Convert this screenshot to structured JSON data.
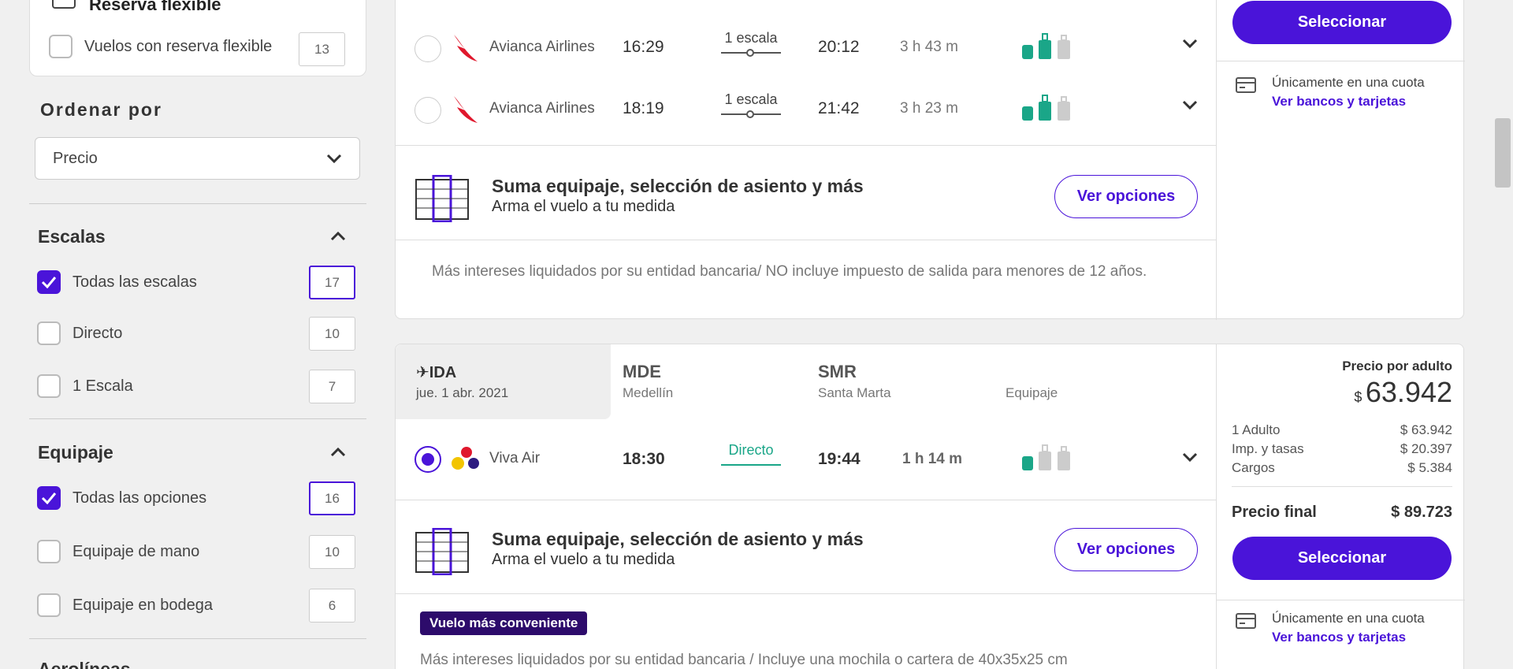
{
  "sidebar": {
    "flex_section_title": "Reserva flexible",
    "flex_option": {
      "label": "Vuelos con reserva flexible",
      "count": "13"
    },
    "order": {
      "title": "Ordenar por",
      "selected": "Precio"
    },
    "stops": {
      "title": "Escalas",
      "options": [
        {
          "label": "Todas las escalas",
          "count": "17",
          "checked": true
        },
        {
          "label": "Directo",
          "count": "10",
          "checked": false
        },
        {
          "label": "1 Escala",
          "count": "7",
          "checked": false
        }
      ]
    },
    "baggage": {
      "title": "Equipaje",
      "options": [
        {
          "label": "Todas las opciones",
          "count": "16",
          "checked": true
        },
        {
          "label": "Equipaje de mano",
          "count": "10",
          "checked": false
        },
        {
          "label": "Equipaje en bodega",
          "count": "6",
          "checked": false
        }
      ]
    },
    "next_section_title": "Aerolíneas"
  },
  "card1": {
    "flights": [
      {
        "airline": "Avianca Airlines",
        "depart": "16:29",
        "stops": "1 escala",
        "arrive": "20:12",
        "duration": "3 h 43 m"
      },
      {
        "airline": "Avianca Airlines",
        "depart": "18:19",
        "stops": "1 escala",
        "arrive": "21:42",
        "duration": "3 h 23 m"
      }
    ],
    "upsell": {
      "title": "Suma equipaje, selección de asiento y más",
      "subtitle": "Arma el vuelo a tu medida",
      "button": "Ver opciones"
    },
    "note": "Más intereses liquidados por su entidad bancaria/ NO incluye impuesto de salida para menores de 12 años.",
    "select_button": "Seleccionar",
    "payment": {
      "text": "Únicamente en una cuota",
      "link": "Ver bancos y tarjetas"
    }
  },
  "card2": {
    "header": {
      "direction": "IDA",
      "date": "jue. 1 abr. 2021",
      "origin_code": "MDE",
      "origin_city": "Medellín",
      "dest_code": "SMR",
      "dest_city": "Santa Marta",
      "baggage_label": "Equipaje"
    },
    "flight": {
      "airline": "Viva Air",
      "depart": "18:30",
      "stops": "Directo",
      "arrive": "19:44",
      "duration": "1 h 14 m"
    },
    "upsell": {
      "title": "Suma equipaje, selección de asiento y más",
      "subtitle": "Arma el vuelo a tu medida",
      "button": "Ver opciones"
    },
    "badge": "Vuelo más conveniente",
    "note": "Más intereses liquidados por su entidad bancaria / Incluye una mochila o cartera de 40x35x25 cm",
    "price": {
      "label": "Precio por adulto",
      "currency": "$",
      "amount": "63.942",
      "rows": [
        {
          "label": "1 Adulto",
          "value": "$ 63.942"
        },
        {
          "label": "Imp. y tasas",
          "value": "$ 20.397"
        },
        {
          "label": "Cargos",
          "value": "$ 5.384"
        }
      ],
      "final_label": "Precio final",
      "final_value": "$ 89.723"
    },
    "select_button": "Seleccionar",
    "payment": {
      "text": "Únicamente en una cuota",
      "link": "Ver bancos y tarjetas"
    }
  },
  "colors": {
    "accent": "#4a14d9",
    "baggage_green": "#1aa688",
    "badge": "#2d0b6b"
  }
}
